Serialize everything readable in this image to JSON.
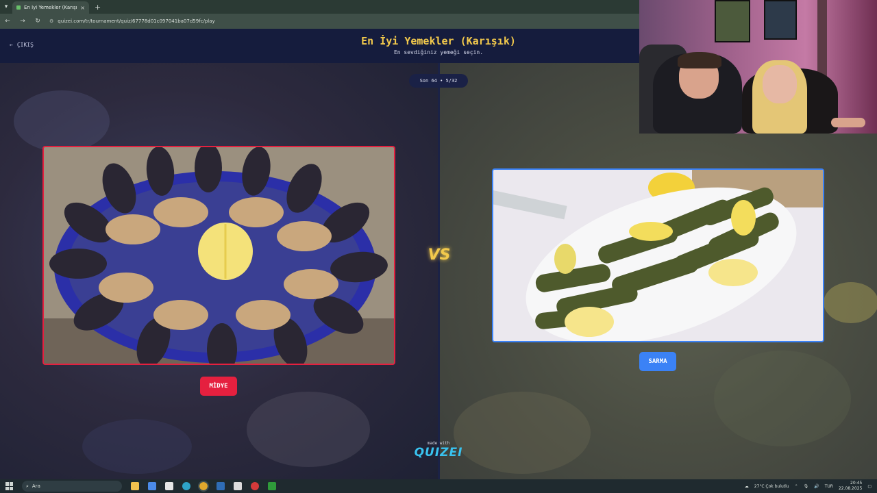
{
  "browser": {
    "tab_title": "En İyi Yemekler (Karışık) - Quize...",
    "tab_close": "×",
    "new_tab": "+",
    "url": "quizei.com/tr/tournament/quiz/67778d01c097041ba07d59fc/play"
  },
  "header": {
    "exit_label": "ÇIKIŞ",
    "title": "En İyi Yemekler (Karışık)",
    "subtitle": "En sevdiğiniz yemeği seçin."
  },
  "round": {
    "label": "Son 64 • 5/32"
  },
  "choices": {
    "left": {
      "name": "MİDYE",
      "accent": "#e5203f"
    },
    "right": {
      "name": "SARMA",
      "accent": "#3b82f6"
    }
  },
  "vs_text": "VS",
  "branding": {
    "made_with": "made with",
    "logo": "QUIZEI"
  },
  "taskbar": {
    "search_placeholder": "Ara",
    "weather": "27°C  Çok bulutlu",
    "language": "TUR",
    "time": "20:45",
    "date": "22.08.2025"
  }
}
